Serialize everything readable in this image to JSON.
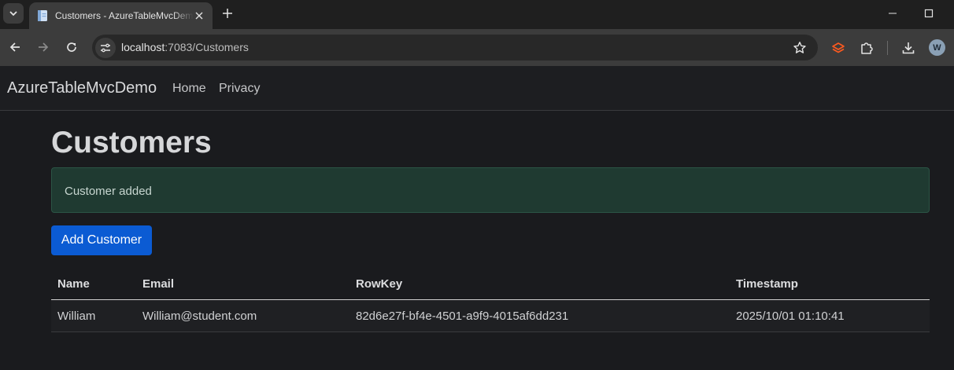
{
  "browser": {
    "tab_title": "Customers - AzureTableMvcDemo",
    "url_host": "localhost",
    "url_rest": ":7083/Customers",
    "avatar_letter": "W",
    "accent_color": "#ff5a1f"
  },
  "navbar": {
    "brand": "AzureTableMvcDemo",
    "links": [
      "Home",
      "Privacy"
    ]
  },
  "page": {
    "title": "Customers",
    "alert": "Customer added",
    "alert_color": "#1f3a31",
    "add_button": "Add Customer",
    "button_color": "#0b5bd3"
  },
  "table": {
    "columns": [
      "Name",
      "Email",
      "RowKey",
      "Timestamp"
    ],
    "rows": [
      [
        "William",
        "William@student.com",
        "82d6e27f-bf4e-4501-a9f9-4015af6dd231",
        "2025/10/01 01:10:41"
      ]
    ]
  }
}
